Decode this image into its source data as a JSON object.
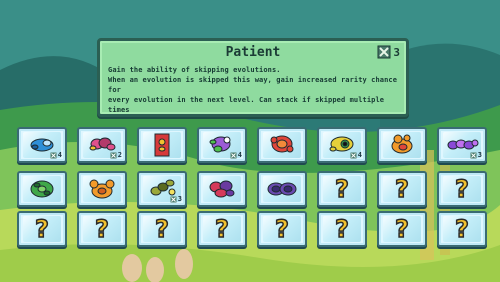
{
  "tooltip": {
    "title": "Patient",
    "description_line1": "Gain the ability of skipping evolutions.",
    "description_line2": "When an evolution is skipped this way, gain increased rarity chance for",
    "description_line3": "every evolution in the next level. Can stack if skipped multiple times",
    "cost": "3",
    "cost_icon": "skip-x-icon"
  },
  "evolutions": [
    {
      "name": "blue-cell-icon",
      "count": "4",
      "colors": [
        "#2f8fd8",
        "#1a5f9f"
      ]
    },
    {
      "name": "pink-worm-icon",
      "count": "2",
      "colors": [
        "#e0508c",
        "#b33a6a"
      ]
    },
    {
      "name": "red-card-icon",
      "count": "",
      "colors": [
        "#d63a3a",
        "#f2c230"
      ]
    },
    {
      "name": "purple-green-blob-icon",
      "count": "4",
      "colors": [
        "#9b5bd6",
        "#4fc04f"
      ]
    },
    {
      "name": "red-orange-blob-icon",
      "count": "",
      "colors": [
        "#e0463a",
        "#f28a3a"
      ]
    },
    {
      "name": "yellow-eye-blob-icon",
      "count": "4",
      "colors": [
        "#e6d03a",
        "#3aa04a"
      ]
    },
    {
      "name": "orange-flame-blob-icon",
      "count": "",
      "colors": [
        "#f29a2a",
        "#e0463a"
      ]
    },
    {
      "name": "purple-chain-icon",
      "count": "3",
      "colors": [
        "#8a4ad6",
        "#c070f0"
      ]
    },
    {
      "name": "green-spiky-icon",
      "count": "",
      "colors": [
        "#3fa84a",
        "#1f6a2a"
      ]
    },
    {
      "name": "orange-crab-icon",
      "count": "",
      "colors": [
        "#f29a2a",
        "#d06020"
      ]
    },
    {
      "name": "olive-worm-icon",
      "count": "3",
      "colors": [
        "#9aa83a",
        "#5a6a1f"
      ]
    },
    {
      "name": "red-purple-cluster-icon",
      "count": "",
      "colors": [
        "#d63a5a",
        "#6a3aa0"
      ]
    },
    {
      "name": "purple-goggles-icon",
      "count": "",
      "colors": [
        "#6a4ab0",
        "#3a2a70"
      ]
    }
  ],
  "locked_slot_label": "?",
  "locked_count": 11
}
